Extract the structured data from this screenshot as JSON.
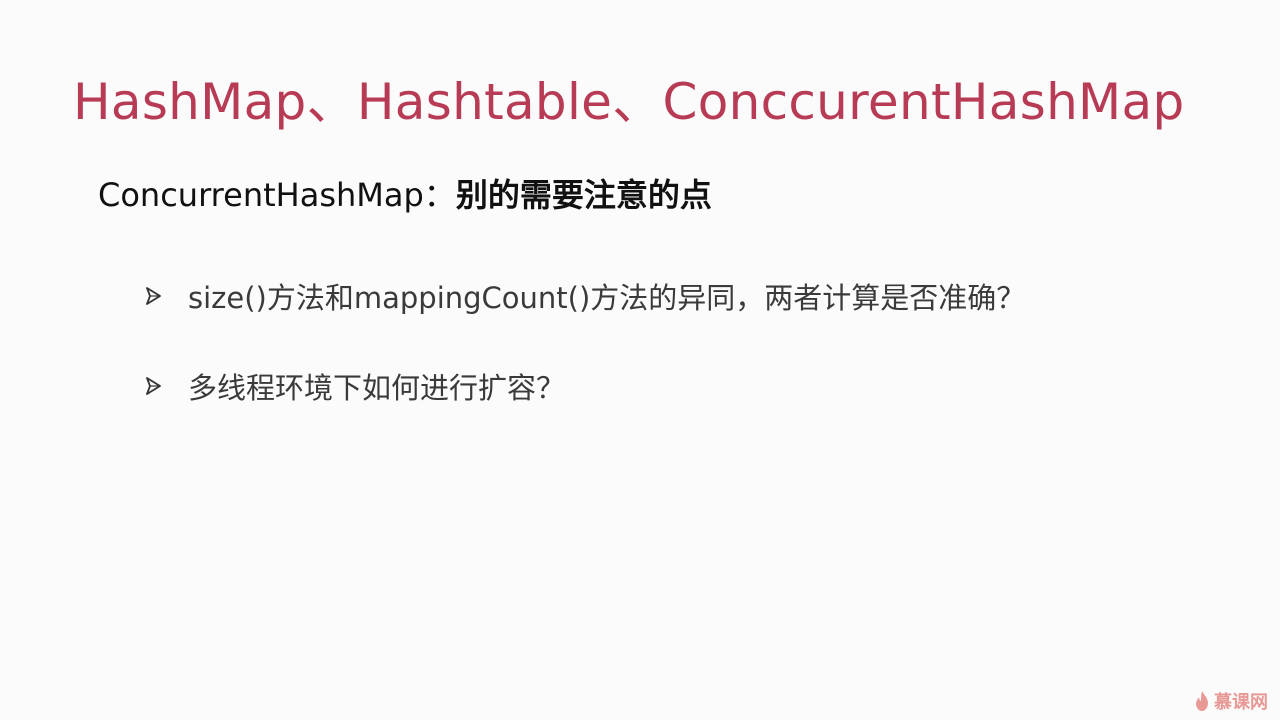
{
  "slide": {
    "title": "HashMap、Hashtable、ConccurentHashMap",
    "subtitle_en": "ConcurrentHashMap：",
    "subtitle_cn": "别的需要注意的点",
    "bullets": [
      "size()方法和mappingCount()方法的异同，两者计算是否准确？",
      "多线程环境下如何进行扩容？"
    ]
  },
  "icons": {
    "bullet": "arrow-bullet-icon",
    "watermark": "flame-icon"
  },
  "watermark": {
    "text": "慕课网"
  },
  "colors": {
    "title": "#b83b55",
    "text": "#3a3a3a",
    "watermark": "#d94a43"
  }
}
